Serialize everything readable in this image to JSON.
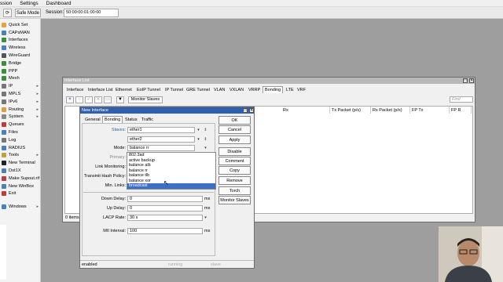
{
  "menubar": {
    "items": [
      "ssion",
      "Settings",
      "Dashboard"
    ]
  },
  "toolbar": {
    "safe_mode": "Safe Mode",
    "session_label": "Session:",
    "session_value": "50:00:00:01:00:00"
  },
  "sidebar": {
    "items": [
      {
        "label": "Quick Set",
        "color": "#e8a23a",
        "arrow": false
      },
      {
        "label": "CAPsMAN",
        "color": "#4a7fc1",
        "arrow": false
      },
      {
        "label": "Interfaces",
        "color": "#3b8f3b",
        "arrow": false
      },
      {
        "label": "Wireless",
        "color": "#4a7fc1",
        "arrow": false
      },
      {
        "label": "WireGuard",
        "color": "#555555",
        "arrow": false
      },
      {
        "label": "Bridge",
        "color": "#3b8f3b",
        "arrow": false
      },
      {
        "label": "PPP",
        "color": "#3b8f3b",
        "arrow": false
      },
      {
        "label": "Mesh",
        "color": "#3b8f3b",
        "arrow": false
      },
      {
        "label": "IP",
        "color": "#777777",
        "arrow": true
      },
      {
        "label": "MPLS",
        "color": "#777777",
        "arrow": true
      },
      {
        "label": "IPv6",
        "color": "#777777",
        "arrow": true
      },
      {
        "label": "Routing",
        "color": "#d9a03a",
        "arrow": true
      },
      {
        "label": "System",
        "color": "#888888",
        "arrow": true
      },
      {
        "label": "Queues",
        "color": "#c43a3a",
        "arrow": false
      },
      {
        "label": "Files",
        "color": "#4a7fc1",
        "arrow": false
      },
      {
        "label": "Log",
        "color": "#777777",
        "arrow": false
      },
      {
        "label": "RADIUS",
        "color": "#4a7fc1",
        "arrow": false
      },
      {
        "label": "Tools",
        "color": "#c4a03a",
        "arrow": true
      },
      {
        "label": "New Terminal",
        "color": "#222222",
        "arrow": false
      },
      {
        "label": "Dot1X",
        "color": "#4a7fc1",
        "arrow": false
      },
      {
        "label": "Make Supout.rif",
        "color": "#c43a3a",
        "arrow": false
      },
      {
        "label": "New WinBox",
        "color": "#4a7fc1",
        "arrow": false
      },
      {
        "label": "Exit",
        "color": "#c43a3a",
        "arrow": false
      },
      {
        "label": "Windows",
        "color": "#4a7fc1",
        "arrow": true
      }
    ]
  },
  "iface_list": {
    "title": "Interface List",
    "tabs": [
      "Interface",
      "Interface List",
      "Ethernet",
      "EoIP Tunnel",
      "IP Tunnel",
      "GRE Tunnel",
      "VLAN",
      "VXLAN",
      "VRRP",
      "Bonding",
      "LTE",
      "VRF"
    ],
    "active_tab": "Bonding",
    "monitor_slaves": "Monitor Slaves",
    "find_placeholder": "Find",
    "columns": [
      "Rx",
      "Tx Packet (p/s)",
      "Rx Packet (p/s)",
      "FP Tx",
      "FP R"
    ],
    "item_count": "0 items"
  },
  "new_iface": {
    "title": "New Interface",
    "tabs": [
      "General",
      "Bonding",
      "Status",
      "Traffic"
    ],
    "active_tab": "Bonding",
    "slaves_label": "Slaves:",
    "slave1": "ether1",
    "slave2": "ether2",
    "mode_label": "Mode:",
    "mode_value": "balance rr",
    "primary_label": "Primary:",
    "link_monitoring_label": "Link Monitoring:",
    "transmit_hash_label": "Transmit Hash Policy:",
    "min_links_label": "Min. Links:",
    "mode_options": [
      "802.3ad",
      "active backup",
      "balance alb",
      "balance rr",
      "balance tlb",
      "balance xor",
      "broadcast"
    ],
    "selected_option": "broadcast",
    "down_delay_label": "Down Delay:",
    "down_delay": "0",
    "up_delay_label": "Up Delay:",
    "up_delay": "0",
    "lacp_rate_label": "LACP Rate:",
    "lacp_rate": "30 s",
    "mii_label": "MII Interval:",
    "mii": "100",
    "unit": "ms",
    "buttons": [
      "OK",
      "Cancel",
      "Apply",
      "Disable",
      "Comment",
      "Copy",
      "Remove",
      "Torch",
      "Monitor Slaves"
    ],
    "status": [
      "enabled",
      "running",
      "slave"
    ]
  },
  "colors": {
    "desktop": "#9e9e9e",
    "active_title": "#2f5fae",
    "inactive_title": "#b8b8b8",
    "selection": "#3b6fc9"
  }
}
